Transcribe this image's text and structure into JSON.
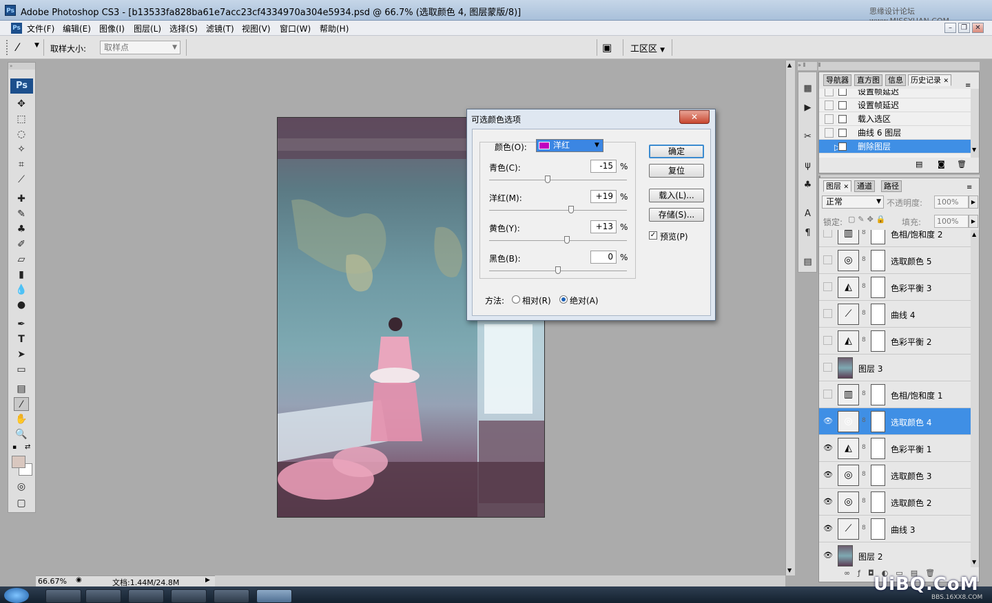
{
  "window": {
    "title": "Adobe Photoshop CS3 - [b13533fa828ba61e7acc23cf4334970a304e5934.psd @ 66.7% (选取颜色 4, 图层蒙版/8)]",
    "watermark": "思缘设计论坛 www.MISSYUAN.COM"
  },
  "menu": [
    "文件(F)",
    "编辑(E)",
    "图像(I)",
    "图层(L)",
    "选择(S)",
    "滤镜(T)",
    "视图(V)",
    "窗口(W)",
    "帮助(H)"
  ],
  "options": {
    "sample_size_label": "取样大小:",
    "sample_value": "取样点",
    "workspace_label": "工区区"
  },
  "status": {
    "zoom": "66.67%",
    "doc": "文档:1.44M/24.8M"
  },
  "history_panel": {
    "tabs": [
      "导航器",
      "直方图",
      "信息",
      "历史记录"
    ],
    "items": [
      "设置帧延迟",
      "设置帧延迟",
      "载入选区",
      "曲线 6 图层",
      "删除图层"
    ],
    "selected_index": 4
  },
  "layers_panel": {
    "tabs": [
      "图层",
      "通道",
      "路径"
    ],
    "blend_mode": "正常",
    "opacity_label": "不透明度:",
    "opacity": "100%",
    "lock_label": "锁定:",
    "fill_label": "填充:",
    "fill": "100%",
    "layers": [
      {
        "name": "色相/饱和度 2",
        "visible": false,
        "kind": "adj",
        "icon": "hue-icon"
      },
      {
        "name": "选取颜色 5",
        "visible": false,
        "kind": "adj",
        "icon": "selective-icon"
      },
      {
        "name": "色彩平衡 3",
        "visible": false,
        "kind": "adj",
        "icon": "balance-icon"
      },
      {
        "name": "曲线 4",
        "visible": false,
        "kind": "adj",
        "icon": "curves-icon"
      },
      {
        "name": "色彩平衡 2",
        "visible": false,
        "kind": "adj",
        "icon": "balance-icon"
      },
      {
        "name": "图层 3",
        "visible": false,
        "kind": "pixel",
        "icon": "photo-icon"
      },
      {
        "name": "色相/饱和度 1",
        "visible": false,
        "kind": "adj",
        "icon": "hue-icon"
      },
      {
        "name": "选取颜色 4",
        "visible": true,
        "kind": "adj",
        "icon": "selective-icon",
        "selected": true
      },
      {
        "name": "色彩平衡 1",
        "visible": true,
        "kind": "adj",
        "icon": "balance-icon"
      },
      {
        "name": "选取颜色 3",
        "visible": true,
        "kind": "adj",
        "icon": "selective-icon"
      },
      {
        "name": "选取颜色 2",
        "visible": true,
        "kind": "adj",
        "icon": "selective-icon"
      },
      {
        "name": "曲线 3",
        "visible": true,
        "kind": "adj",
        "icon": "curves-icon"
      },
      {
        "name": "图层 2",
        "visible": true,
        "kind": "pixel",
        "icon": "photo-icon"
      }
    ]
  },
  "dialog": {
    "title": "可选颜色选项",
    "colors_label": "颜色(O):",
    "color_value": "洋红",
    "color_swatch": "#c000c0",
    "sliders": [
      {
        "label": "青色(C):",
        "value": "-15",
        "level": -15
      },
      {
        "label": "洋红(M):",
        "value": "+19",
        "level": 19
      },
      {
        "label": "黄色(Y):",
        "value": "+13",
        "level": 13
      },
      {
        "label": "黑色(B):",
        "value": "0",
        "level": 0
      }
    ],
    "percent": "%",
    "ok": "确定",
    "reset": "复位",
    "load": "载入(L)...",
    "save": "存储(S)...",
    "preview": "预览(P)",
    "method_label": "方法:",
    "relative": "相对(R)",
    "absolute": "绝对(A)"
  },
  "logo": {
    "text": "UiBQ.CoM",
    "sub": "BBS.16XX8.COM"
  }
}
